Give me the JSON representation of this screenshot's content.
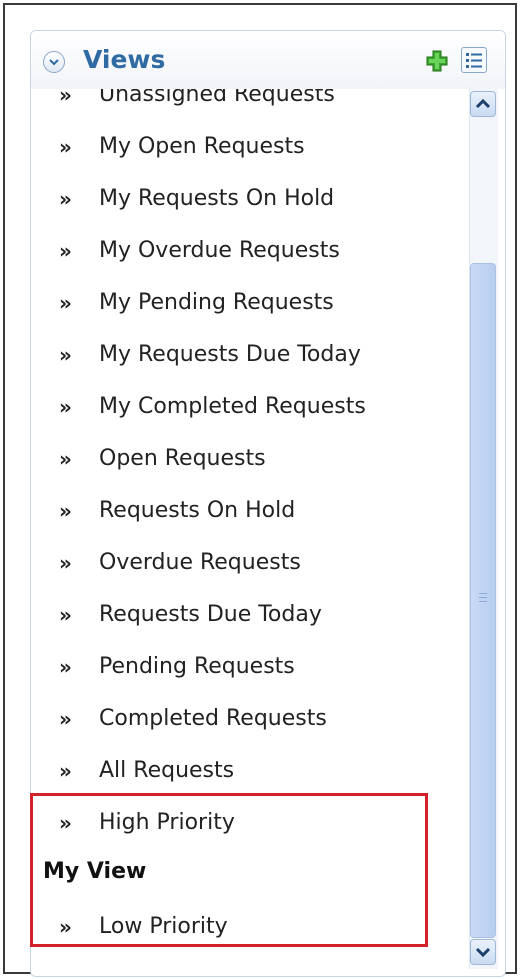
{
  "panel": {
    "title": "Views",
    "items_before": [
      "Unassigned Requests",
      "My Open Requests",
      "My Requests On Hold",
      "My Overdue Requests",
      "My Pending Requests",
      "My Requests Due Today",
      "My Completed Requests",
      "Open Requests",
      "Requests On Hold",
      "Overdue Requests",
      "Requests Due Today",
      "Pending Requests",
      "Completed Requests",
      "All Requests",
      "High Priority"
    ],
    "group_heading": "My View",
    "items_after": [
      "Low Priority"
    ],
    "arrow_glyph": "»"
  },
  "icons": {
    "collapse": "collapse-circle-icon",
    "add": "add-plus-icon",
    "list": "list-view-icon",
    "scroll_up": "scroll-up-arrow-icon",
    "scroll_down": "scroll-down-arrow-icon"
  },
  "colors": {
    "title": "#2f6aa3",
    "add_icon": "#3aa82a",
    "highlight_border": "#d4202a",
    "scroll_thumb": "#c0d3f3"
  }
}
